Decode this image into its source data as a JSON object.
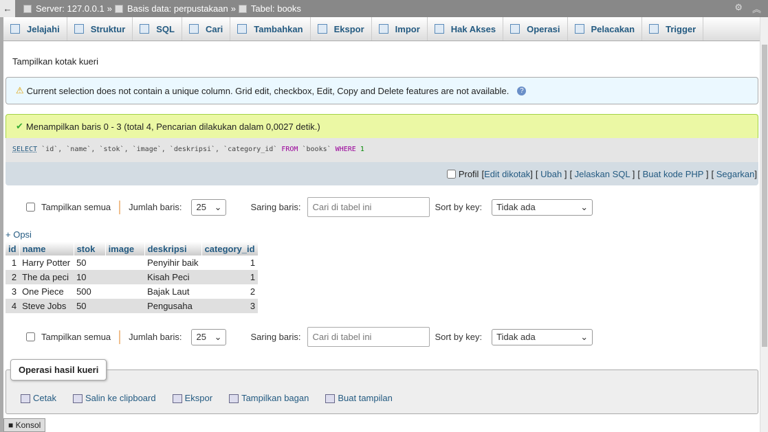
{
  "breadcrumb": {
    "server": "Server: 127.0.0.1",
    "database": "Basis data: perpustakaan",
    "table": "Tabel: books",
    "sep": "»"
  },
  "tabs": [
    {
      "label": "Jelajahi",
      "icon": "browse-icon"
    },
    {
      "label": "Struktur",
      "icon": "structure-icon"
    },
    {
      "label": "SQL",
      "icon": "sql-icon"
    },
    {
      "label": "Cari",
      "icon": "search-icon"
    },
    {
      "label": "Tambahkan",
      "icon": "insert-icon"
    },
    {
      "label": "Ekspor",
      "icon": "export-icon"
    },
    {
      "label": "Impor",
      "icon": "import-icon"
    },
    {
      "label": "Hak Akses",
      "icon": "privileges-icon"
    },
    {
      "label": "Operasi",
      "icon": "wrench-icon"
    },
    {
      "label": "Pelacakan",
      "icon": "eye-icon"
    },
    {
      "label": "Trigger",
      "icon": "trigger-icon"
    }
  ],
  "show_query_box": "Tampilkan kotak kueri",
  "warning": "Current selection does not contain a unique column. Grid edit, checkbox, Edit, Copy and Delete features are not available.",
  "success": "Menampilkan baris 0 - 3 (total 4, Pencarian dilakukan dalam 0,0027 detik.)",
  "sql": {
    "select": "SELECT",
    "fields": "`id`, `name`, `stok`, `image`, `deskripsi`, `category_id`",
    "from": "FROM",
    "table": "`books`",
    "where": "WHERE",
    "cond": "1"
  },
  "sql_links": {
    "profil": "Profil",
    "edit_inline": "Edit dikotak",
    "edit": "Ubah",
    "explain": "Jelaskan SQL",
    "php": "Buat kode PHP",
    "refresh": "Segarkan"
  },
  "nav": {
    "show_all": "Tampilkan semua",
    "rows_label": "Jumlah baris:",
    "rows_value": "25",
    "filter_label": "Saring baris:",
    "filter_placeholder": "Cari di tabel ini",
    "sort_label": "Sort by key:",
    "sort_value": "Tidak ada"
  },
  "options": "+ Opsi",
  "table": {
    "columns": [
      "id",
      "name",
      "stok",
      "image",
      "deskripsi",
      "category_id"
    ],
    "rows": [
      [
        "1",
        "Harry Potter",
        "50",
        "",
        "Penyihir baik",
        "1"
      ],
      [
        "2",
        "The da peci",
        "10",
        "",
        "Kisah Peci",
        "1"
      ],
      [
        "3",
        "One Piece",
        "500",
        "",
        "Bajak Laut",
        "2"
      ],
      [
        "4",
        "Steve Jobs",
        "50",
        "",
        "Pengusaha",
        "3"
      ]
    ]
  },
  "query_ops": {
    "title": "Operasi hasil kueri",
    "links": [
      "Cetak",
      "Salin ke clipboard",
      "Ekspor",
      "Tampilkan bagan",
      "Buat tampilan"
    ]
  },
  "console": "Konsol"
}
